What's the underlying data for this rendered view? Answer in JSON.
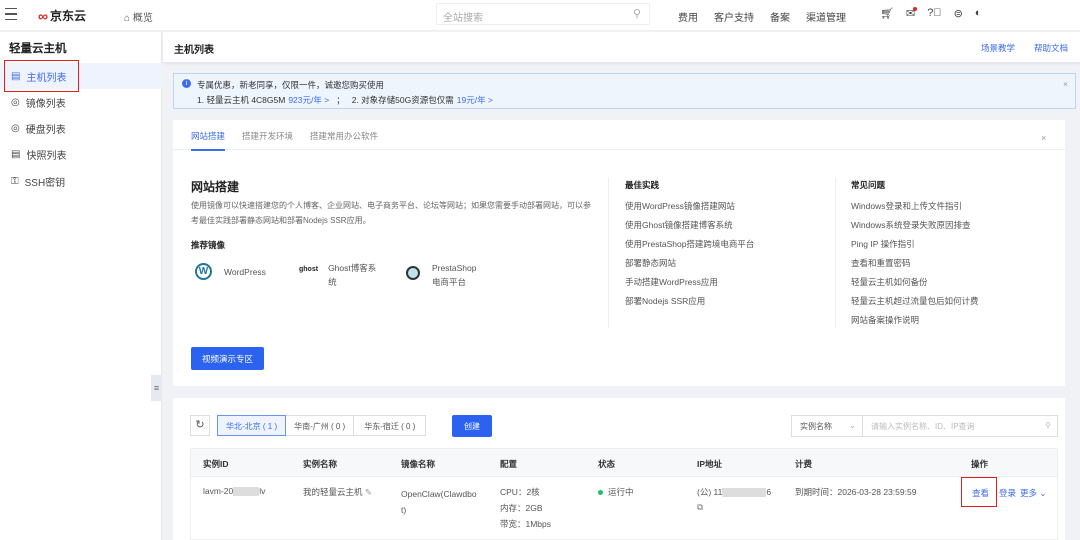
{
  "topbar": {
    "brand": "京东云",
    "overview": "概览",
    "search_placeholder": "全站搜索",
    "nav": [
      "费用",
      "客户支持",
      "备案",
      "渠道管理"
    ]
  },
  "sidebar": {
    "title": "轻量云主机",
    "items": [
      {
        "label": "主机列表"
      },
      {
        "label": "镜像列表"
      },
      {
        "label": "硬盘列表"
      },
      {
        "label": "快照列表"
      },
      {
        "label": "SSH密钥"
      }
    ]
  },
  "header": {
    "title": "主机列表",
    "links": [
      "场景教学",
      "帮助文档"
    ]
  },
  "banner": {
    "line1": "专属优惠，新老同享，仅限一件，诚邀您购买使用",
    "p1": "1. 轻量云主机 4C8G5M",
    "p1_price": "923元/年 >",
    "sep": "；",
    "p2": "2. 对象存储50G资源包仅需",
    "p2_price": "19元/年 >"
  },
  "guide": {
    "tabs": [
      "网站搭建",
      "搭建开发环境",
      "搭建常用办公软件"
    ],
    "title": "网站搭建",
    "desc": "使用镜像可以快速搭建您的个人博客、企业网站、电子商务平台、论坛等网站；如果您需要手动部署网站，可以参考最佳实践部署静态网站和部署Nodejs SSR应用。",
    "rec_title": "推荐镜像",
    "images": [
      {
        "label": "WordPress"
      },
      {
        "logo": "ghost",
        "label": "Ghost博客系统"
      },
      {
        "label": "PrestaShop电商平台"
      }
    ],
    "video_btn": "视频演示专区",
    "best_title": "最佳实践",
    "best": [
      "使用WordPress镜像搭建网站",
      "使用Ghost镜像搭建博客系统",
      "使用PrestaShop搭建跨境电商平台",
      "部署静态网站",
      "手动搭建WordPress应用",
      "部署Nodejs SSR应用"
    ],
    "faq_title": "常见问题",
    "faq": [
      "Windows登录和上传文件指引",
      "Windows系统登录失败原因排查",
      "Ping IP 操作指引",
      "查看和重置密码",
      "轻量云主机如何备份",
      "轻量云主机超过流量包后如何计费",
      "网站备案操作说明"
    ]
  },
  "list": {
    "regions": [
      "华北-北京 ( 1 )",
      "华南-广州 ( 0 )",
      "华东-宿迁 ( 0 )"
    ],
    "create": "创建",
    "filter": "实例名称",
    "search_placeholder": "请输入实例名称、ID、IP查询",
    "columns": [
      "实例ID",
      "实例名称",
      "镜像名称",
      "配置",
      "状态",
      "IP地址",
      "计费",
      "操作"
    ],
    "rows": [
      {
        "id_a": "lavm-20",
        "id_b": "lv",
        "name": "我的轻量云主机",
        "image": "OpenClaw(Clawdbot)",
        "cpu": "CPU：2核",
        "mem": "内存：2GB",
        "bw": "带宽：1Mbps",
        "status": "运行中",
        "ip_a": "(公) 11",
        "ip_b": "6",
        "billing": "到期时间：2026-03-28 23:59:59",
        "view": "查看",
        "login": "登录",
        "more": "更多"
      }
    ]
  }
}
